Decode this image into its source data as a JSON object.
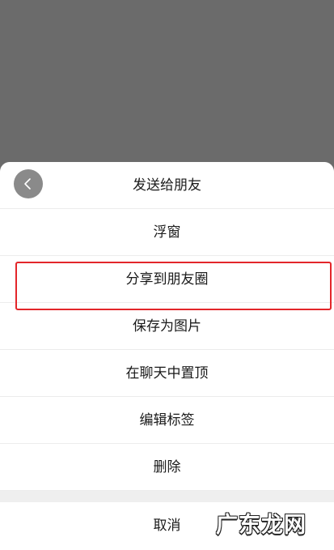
{
  "sheet": {
    "back_icon": "chevron-left-icon",
    "items": [
      {
        "label": "发送给朋友"
      },
      {
        "label": "浮窗"
      },
      {
        "label": "分享到朋友圈"
      },
      {
        "label": "保存为图片"
      },
      {
        "label": "在聊天中置顶"
      },
      {
        "label": "编辑标签"
      },
      {
        "label": "删除"
      }
    ],
    "cancel_label": "取消"
  },
  "annotation": {
    "highlight_color": "#e3262a",
    "highlighted_item": "分享到朋友圈"
  },
  "watermark": {
    "text": "广东龙网"
  },
  "colors": {
    "overlay": "#6b6b6b",
    "sheet_bg": "#ffffff",
    "text": "#1a1a1a"
  }
}
